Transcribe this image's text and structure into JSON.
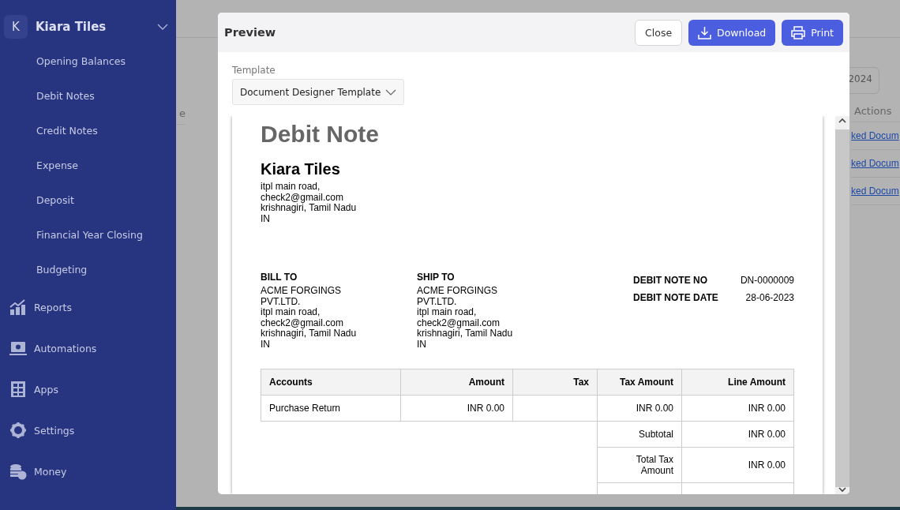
{
  "sidebar": {
    "org": {
      "initial": "K",
      "name": "Kiara Tiles",
      "expanded": true
    },
    "items": [
      {
        "label": "Opening Balances",
        "kind": "sub"
      },
      {
        "label": "Debit Notes",
        "kind": "sub"
      },
      {
        "label": "Credit Notes",
        "kind": "sub"
      },
      {
        "label": "Expense",
        "kind": "sub"
      },
      {
        "label": "Deposit",
        "kind": "sub"
      },
      {
        "label": "Financial Year Closing",
        "kind": "sub"
      },
      {
        "label": "Budgeting",
        "kind": "sub"
      },
      {
        "label": "Reports",
        "kind": "main"
      },
      {
        "label": "Automations",
        "kind": "main"
      },
      {
        "label": "Apps",
        "kind": "main"
      },
      {
        "label": "Settings",
        "kind": "main"
      },
      {
        "label": "Money",
        "kind": "main"
      }
    ]
  },
  "background": {
    "date_field": "2024",
    "table_column_1": "e",
    "actions_header": "Actions",
    "links": [
      "ked Docum",
      "ked Docum",
      "ked Docum"
    ]
  },
  "modal": {
    "title": "Preview",
    "buttons": [
      {
        "label": "Close",
        "kind": "secondary"
      },
      {
        "label": "Download",
        "kind": "download"
      },
      {
        "label": "Print",
        "kind": "print"
      }
    ],
    "template": {
      "label": "Template",
      "value": "Document Designer Template"
    },
    "document": {
      "title": "Debit Note",
      "company": "Kiara Tiles",
      "company_address": [
        "itpl main road,",
        "check2@gmail.com",
        "krishnagiri, Tamil Nadu",
        "IN"
      ],
      "bill_to": {
        "heading": "BILL TO",
        "lines": [
          "ACME FORGINGS",
          "PVT.LTD.",
          "itpl main road,",
          "check2@gmail.com",
          "krishnagiri, Tamil Nadu",
          "IN"
        ]
      },
      "ship_to": {
        "heading": "SHIP TO",
        "lines": [
          "ACME FORGINGS",
          "PVT.LTD.",
          "itpl main road,",
          "check2@gmail.com",
          "krishnagiri, Tamil Nadu",
          "IN"
        ]
      },
      "meta": [
        {
          "label": "DEBIT NOTE NO",
          "value": "DN-0000009"
        },
        {
          "label": "DEBIT NOTE DATE",
          "value": "28-06-2023"
        }
      ],
      "table": {
        "columns": [
          "Accounts",
          "Amount",
          "Tax",
          "Tax Amount",
          "Line Amount"
        ],
        "rows": [
          [
            "Purchase Return",
            "INR 0.00",
            "",
            "INR 0.00",
            "INR 0.00"
          ]
        ]
      },
      "totals": [
        {
          "label": "Subtotal",
          "value": "INR 0.00"
        },
        {
          "label": "Total Tax Amount",
          "value": "INR 0.00"
        }
      ]
    }
  }
}
